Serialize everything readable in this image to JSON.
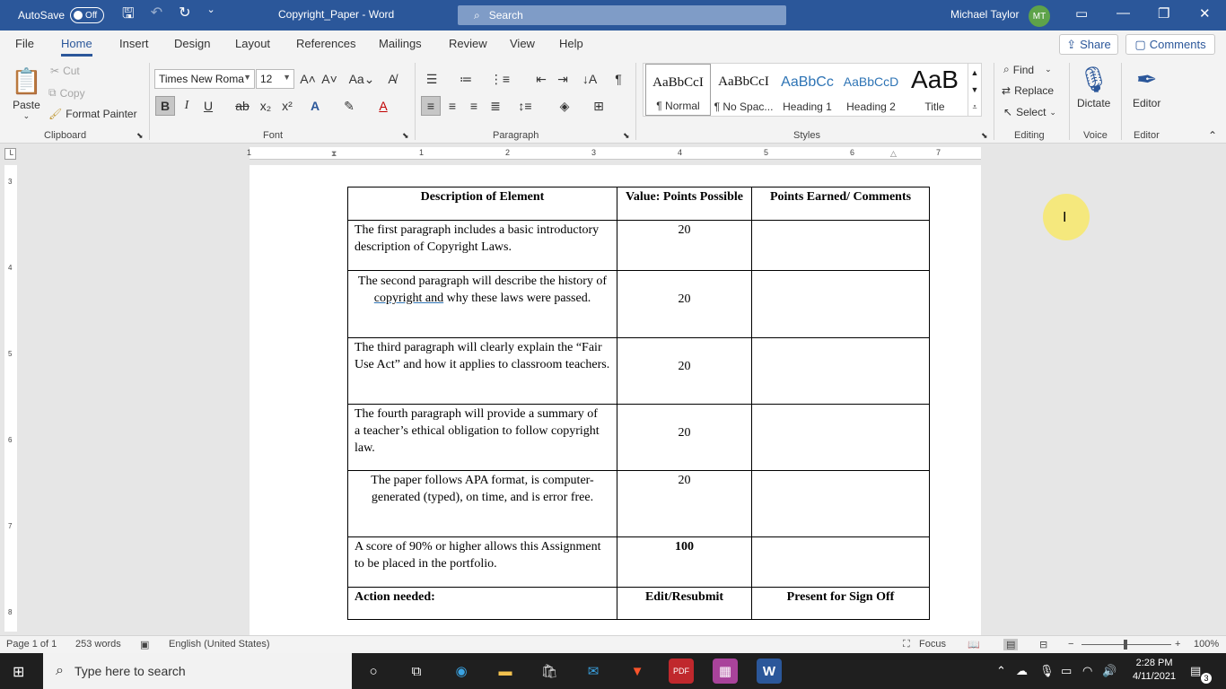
{
  "titlebar": {
    "autosave_label": "AutoSave",
    "autosave_state": "Off",
    "document_title": "Copyright_Paper  -  Word",
    "search_placeholder": "Search",
    "user_name": "Michael Taylor",
    "user_initials": "MT"
  },
  "tabs": [
    "File",
    "Home",
    "Insert",
    "Design",
    "Layout",
    "References",
    "Mailings",
    "Review",
    "View",
    "Help"
  ],
  "active_tab": "Home",
  "share_label": "Share",
  "comments_label": "Comments",
  "ribbon": {
    "clipboard": {
      "paste": "Paste",
      "cut": "Cut",
      "copy": "Copy",
      "format_painter": "Format Painter",
      "group": "Clipboard"
    },
    "font": {
      "font_name": "Times New Roma",
      "font_size": "12",
      "group": "Font"
    },
    "paragraph": {
      "group": "Paragraph"
    },
    "styles": {
      "group": "Styles",
      "items": [
        {
          "preview": "AaBbCcI",
          "name": "¶ Normal"
        },
        {
          "preview": "AaBbCcI",
          "name": "¶ No Spac..."
        },
        {
          "preview": "AaBbCc",
          "name": "Heading 1"
        },
        {
          "preview": "AaBbCcD",
          "name": "Heading 2"
        },
        {
          "preview": "AaB",
          "name": "Title"
        }
      ]
    },
    "editing": {
      "find": "Find",
      "replace": "Replace",
      "select": "Select",
      "group": "Editing"
    },
    "voice": {
      "dictate": "Dictate",
      "group": "Voice"
    },
    "editor": {
      "editor": "Editor",
      "group": "Editor"
    }
  },
  "ruler": {
    "h_numbers": [
      "1",
      "1",
      "2",
      "3",
      "4",
      "5",
      "6",
      "7"
    ],
    "v_numbers": [
      "3",
      "4",
      "5",
      "6",
      "7",
      "8"
    ]
  },
  "document": {
    "header": [
      "Description of Element",
      "Value:  Points Possible",
      "Points Earned/ Comments"
    ],
    "rows": [
      {
        "desc": "The first paragraph includes a basic introductory description of Copyright Laws.",
        "points": "20",
        "comments": ""
      },
      {
        "desc_before": "The second paragraph will describe the history of ",
        "desc_spell": "copyright  and",
        "desc_after": " why these laws were passed.",
        "points": "20",
        "comments": ""
      },
      {
        "desc": "The third paragraph will clearly explain the “Fair Use Act” and how it applies to classroom teachers.",
        "points": "20",
        "comments": ""
      },
      {
        "desc_line1": "The fourth paragraph will provide a summary of",
        "desc_line2": "a teacher’s ethical obligation to follow copyright law.",
        "points": "20",
        "comments": ""
      },
      {
        "desc": "The paper follows APA format, is computer-generated (typed), on time, and is error free.",
        "points": "20",
        "comments": ""
      },
      {
        "desc": "A score of 90% or higher allows this Assignment to be placed in the portfolio.",
        "points": "100",
        "comments": ""
      }
    ],
    "action_row": [
      "Action needed:",
      "Edit/Resubmit",
      "Present for Sign Off"
    ]
  },
  "statusbar": {
    "page": "Page 1 of 1",
    "words": "253 words",
    "language": "English (United States)",
    "focus": "Focus",
    "zoom": "100%"
  },
  "taskbar": {
    "search_placeholder": "Type here to search",
    "time": "2:28 PM",
    "date": "4/11/2021",
    "notification_count": "3"
  },
  "colors": {
    "word_blue": "#2b579a",
    "highlight": "#fae85a",
    "taskbar": "#1f1f1f"
  }
}
